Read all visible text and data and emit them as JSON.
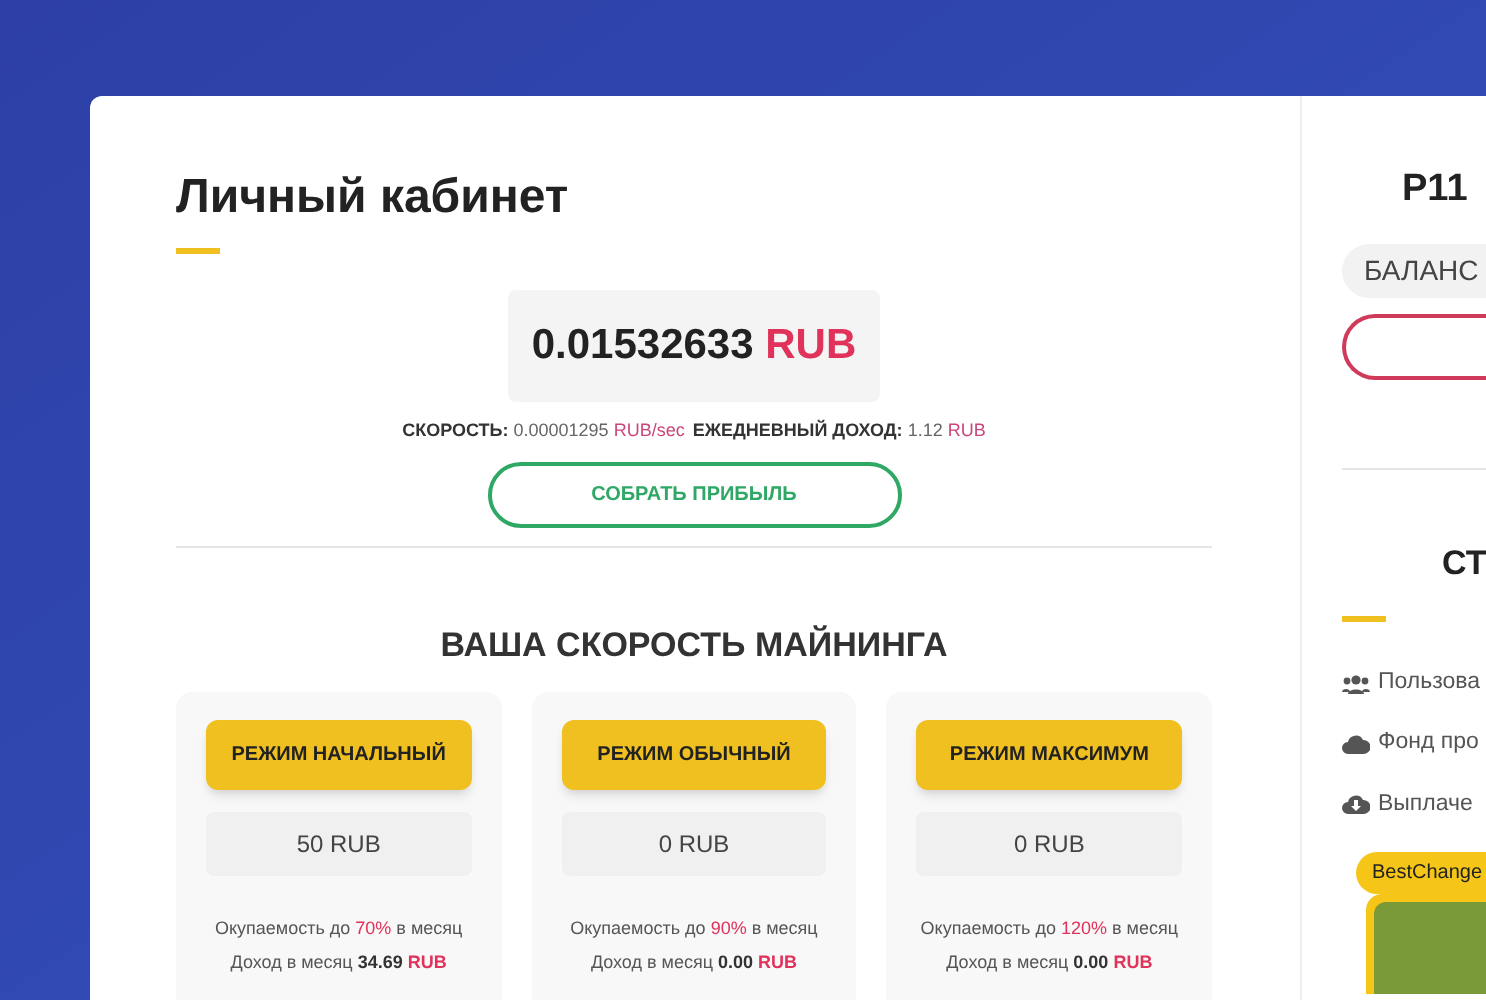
{
  "title": "Личный кабинет",
  "balance": {
    "amount": "0.01532633",
    "currency": "RUB"
  },
  "stats": [
    {
      "label": "СКОРОСТЬ:",
      "value": "0.00001295",
      "unit": "RUB/sec"
    },
    {
      "label": "ЕЖЕДНЕВНЫЙ ДОХОД:",
      "value": "1.12",
      "unit": "RUB"
    }
  ],
  "collect_button": "СОБРАТЬ ПРИБЫЛЬ",
  "speed_heading": "ВАША СКОРОСТЬ МАЙНИНГА",
  "modes": [
    {
      "button": "РЕЖИМ НАЧАЛЬНЫЙ",
      "amount": "50 RUB",
      "payback": "Окупаемость до **70%** в месяц",
      "income": "Доход в месяц **34.69** RUB"
    },
    {
      "button": "РЕЖИМ ОБЫЧНЫЙ",
      "amount": "0 RUB",
      "payback": "Окупаемость до **90%** в месяц",
      "income": "Доход в месяц **0.00** RUB"
    },
    {
      "button": "РЕЖИМ МАКСИМУМ",
      "amount": "0 RUB",
      "payback": "Окупаемость до **120%** в месяц",
      "income": "Доход в месяц **0.00** RUB"
    }
  ],
  "sidebar": {
    "user": "P11",
    "balance_label": "БАЛАНС",
    "stats_heading": "СТ",
    "stats": [
      {
        "kind": "users",
        "label": "Пользова"
      },
      {
        "kind": "cloud",
        "label": "Фонд про"
      },
      {
        "kind": "download",
        "label": "Выплаче"
      }
    ],
    "badge": "BestChange"
  }
}
